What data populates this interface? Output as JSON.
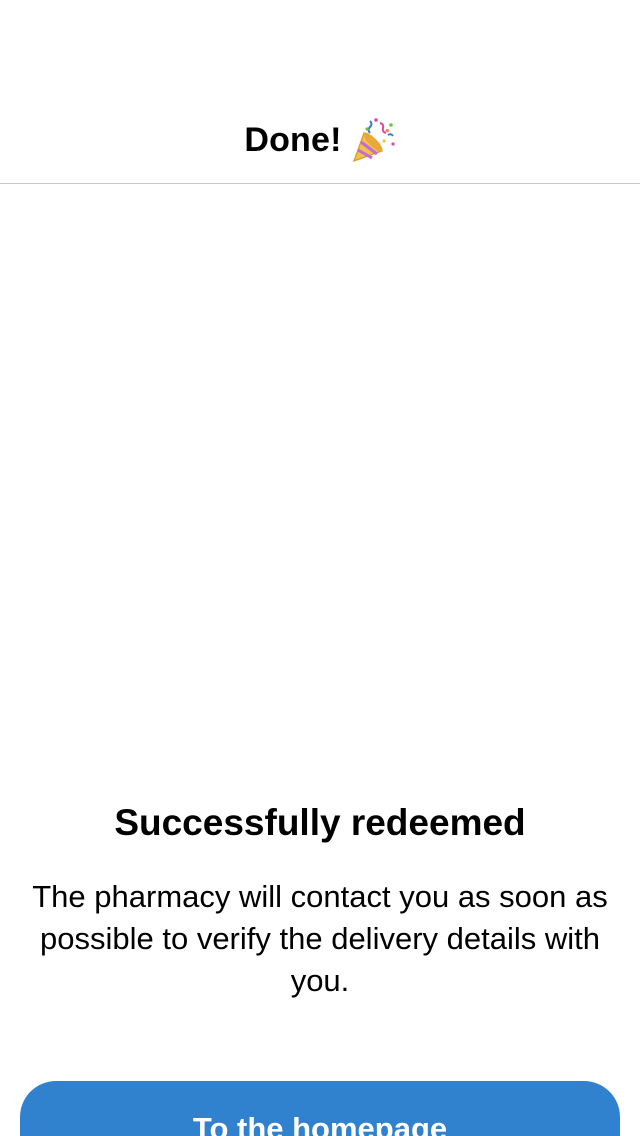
{
  "nav": {
    "title": "Done!",
    "title_icon": "party-popper-icon"
  },
  "message": {
    "title": "Successfully redeemed",
    "body": "The pharmacy will contact you as soon as possible to verify the delivery details with you."
  },
  "actions": {
    "primary_label": "To the homepage"
  },
  "colors": {
    "primary_button": "#3182ce",
    "divider": "#c6c6c8",
    "text": "#000000",
    "background": "#ffffff"
  }
}
